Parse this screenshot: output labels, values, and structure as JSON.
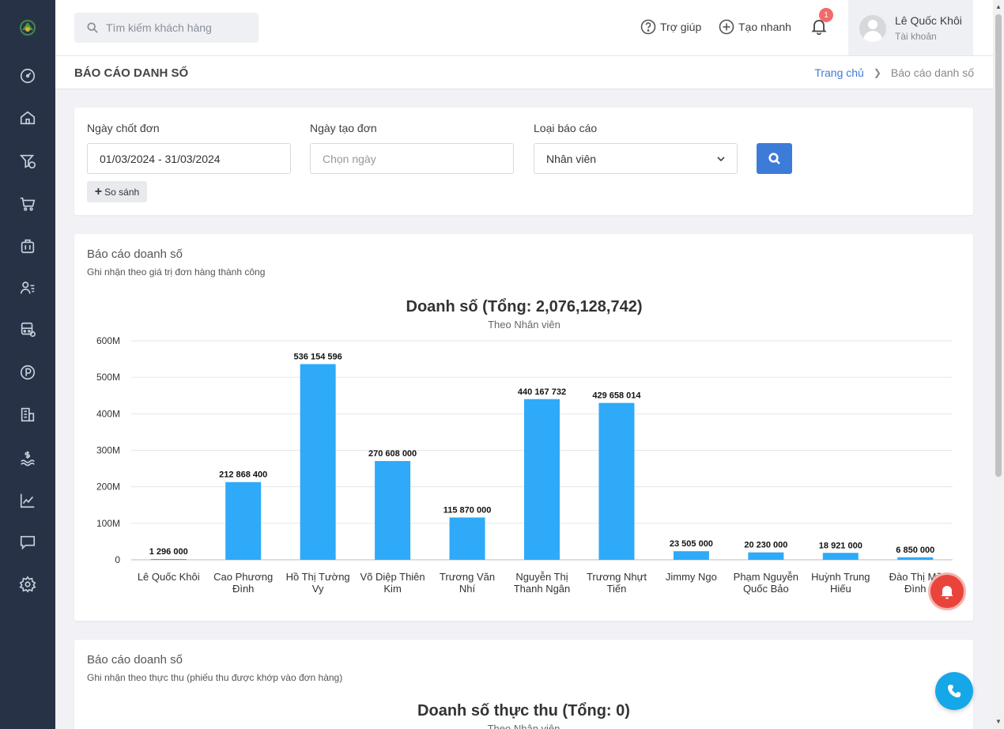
{
  "header": {
    "search_placeholder": "Tìm kiếm khách hàng",
    "help_label": "Trợ giúp",
    "quick_create_label": "Tạo nhanh",
    "notification_count": "1",
    "user_name": "Lê Quốc Khôi",
    "user_role": "Tài khoản"
  },
  "page": {
    "title": "BÁO CÁO DANH SỐ",
    "breadcrumb_home": "Trang chủ",
    "breadcrumb_current": "Báo cáo danh số"
  },
  "filters": {
    "close_date_label": "Ngày chốt đơn",
    "close_date_value": "01/03/2024 - 31/03/2024",
    "create_date_label": "Ngày tạo đơn",
    "create_date_placeholder": "Chọn ngày",
    "report_type_label": "Loại báo cáo",
    "report_type_value": "Nhân viên",
    "compare_label": "So sánh"
  },
  "report1": {
    "title": "Báo cáo doanh số",
    "subtitle": "Ghi nhận theo giá trị đơn hàng thành công"
  },
  "report2": {
    "title": "Báo cáo doanh số",
    "subtitle": "Ghi nhận theo thực thu (phiếu thu được khớp vào đơn hàng)",
    "chart_title": "Doanh số thực thu (Tổng: 0)",
    "chart_subtitle": "Theo Nhân viên"
  },
  "icons": {
    "sidebar": [
      "dashboard-icon",
      "home-icon",
      "funnel-dollar-icon",
      "cart-icon",
      "briefcase-icon",
      "users-list-icon",
      "bus-icon",
      "parking-icon",
      "building-icon",
      "water-dollar-icon",
      "chart-line-icon",
      "chat-icon",
      "settings-icon"
    ]
  },
  "colors": {
    "accent": "#3d7bd9",
    "bar": "#2eaaf8",
    "sidebar": "#283247"
  },
  "chart_data": {
    "type": "bar",
    "title": "Doanh số (Tổng: 2,076,128,742)",
    "subtitle": "Theo Nhân viên",
    "categories": [
      [
        "Lê Quốc Khôi"
      ],
      [
        "Cao Phương",
        "Đình"
      ],
      [
        "Hồ Thị Tường",
        "Vy"
      ],
      [
        "Võ Diệp Thiên",
        "Kim"
      ],
      [
        "Trương Văn",
        "Nhí"
      ],
      [
        "Nguyễn Thị",
        "Thanh Ngân"
      ],
      [
        "Trương Nhựt",
        "Tiến"
      ],
      [
        "Jimmy Ngo"
      ],
      [
        "Phạm Nguyễn",
        "Quốc Bảo"
      ],
      [
        "Huỳnh Trung",
        "Hiếu"
      ],
      [
        "Đào Thị Mỹ",
        "Đình"
      ]
    ],
    "values": [
      1296000,
      212868400,
      536154596,
      270608000,
      115870000,
      440167732,
      429658014,
      23505000,
      20230000,
      18921000,
      6850000
    ],
    "data_labels": [
      "1 296 000",
      "212 868 400",
      "536 154 596",
      "270 608 000",
      "115 870 000",
      "440 167 732",
      "429 658 014",
      "23 505 000",
      "20 230 000",
      "18 921 000",
      "6 850 000"
    ],
    "yticks": [
      "0",
      "100M",
      "200M",
      "300M",
      "400M",
      "500M",
      "600M"
    ],
    "ylim": [
      0,
      600000000
    ],
    "grid": true
  }
}
